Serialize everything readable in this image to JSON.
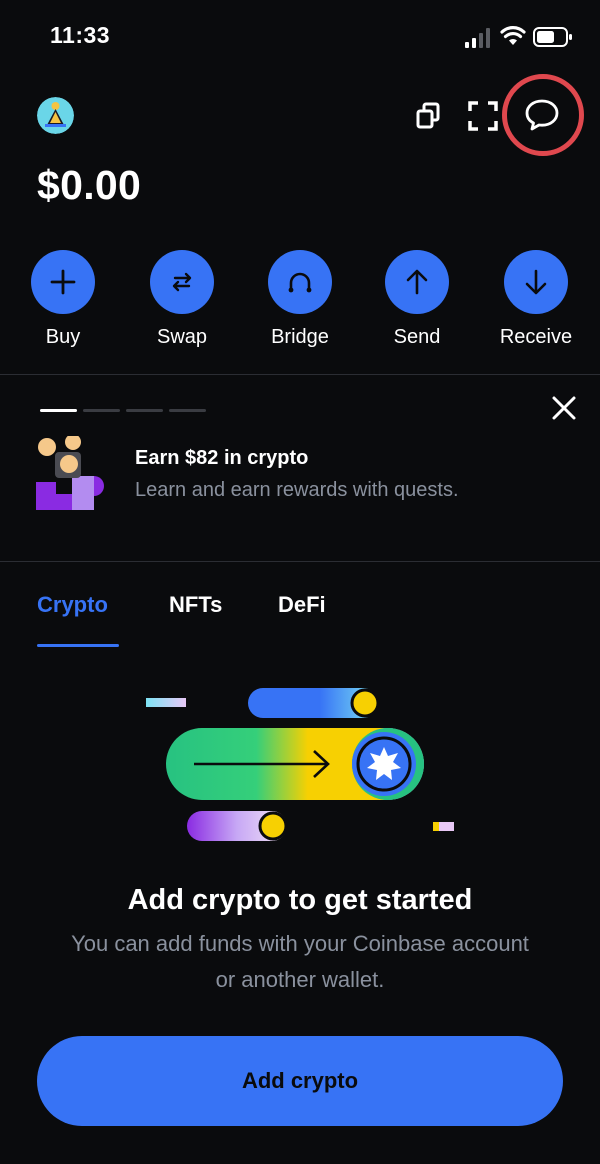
{
  "status_bar": {
    "time": "11:33"
  },
  "header": {
    "balance": "$0.00",
    "icons": [
      "copy-icon",
      "scan-icon",
      "chat-icon"
    ]
  },
  "actions": [
    {
      "label": "Buy",
      "icon": "plus-icon"
    },
    {
      "label": "Swap",
      "icon": "swap-icon"
    },
    {
      "label": "Bridge",
      "icon": "bridge-icon"
    },
    {
      "label": "Send",
      "icon": "arrow-up-icon"
    },
    {
      "label": "Receive",
      "icon": "arrow-down-icon"
    }
  ],
  "promo": {
    "title": "Earn $82 in crypto",
    "subtitle": "Learn and earn rewards with quests.",
    "current_slide": 1,
    "slide_count": 4
  },
  "tabs": [
    {
      "label": "Crypto",
      "active": true
    },
    {
      "label": "NFTs",
      "active": false
    },
    {
      "label": "DeFi",
      "active": false
    }
  ],
  "empty_state": {
    "title": "Add crypto to get started",
    "subtitle": "You can add funds with your Coinbase account or another wallet.",
    "button_label": "Add crypto"
  },
  "colors": {
    "background": "#0a0b0d",
    "accent": "#3773f5",
    "muted_text": "#8a919e",
    "highlight_ring": "#e0484e"
  }
}
